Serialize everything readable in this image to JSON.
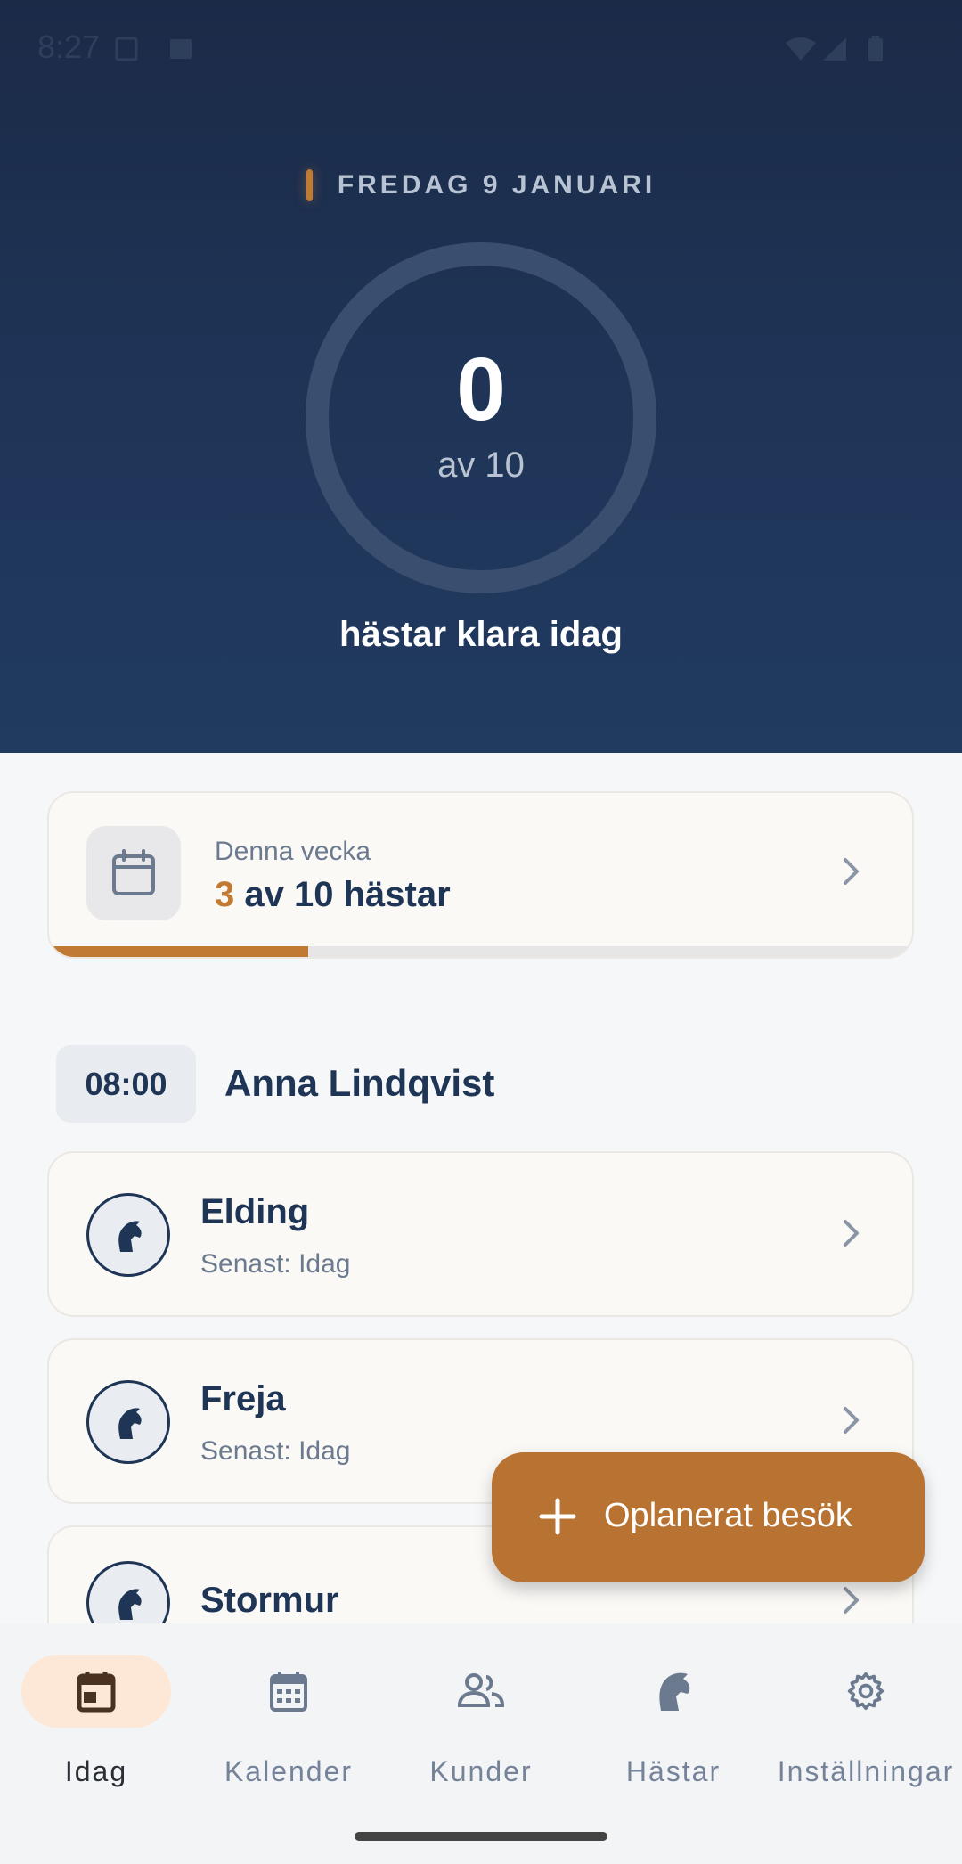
{
  "status_bar": {
    "time": "8:27"
  },
  "header": {
    "date": "FREDAG 9 JANUARI",
    "done_count": "0",
    "total_label": "av 10",
    "caption": "hästar klara idag",
    "progress_fraction": 0
  },
  "week": {
    "label": "Denna vecka",
    "done": "3",
    "rest": " av 10 hästar",
    "progress_fraction": 0.3
  },
  "visit": {
    "time": "08:00",
    "customer": "Anna Lindqvist",
    "horses": [
      {
        "name": "Elding",
        "subtitle": "Senast: Idag"
      },
      {
        "name": "Freja",
        "subtitle": "Senast: Idag"
      },
      {
        "name": "Stormur",
        "subtitle": ""
      }
    ]
  },
  "fab": {
    "label": "Oplanerat besök"
  },
  "nav": {
    "items": [
      {
        "label": "Idag",
        "icon": "calendar-today-icon"
      },
      {
        "label": "Kalender",
        "icon": "calendar-month-icon"
      },
      {
        "label": "Kunder",
        "icon": "people-icon"
      },
      {
        "label": "Hästar",
        "icon": "horse-head-icon"
      },
      {
        "label": "Inställningar",
        "icon": "gear-icon"
      }
    ],
    "active_index": 0
  },
  "colors": {
    "navy": "#1f3556",
    "accent": "#c07a34",
    "hero_bg": "#1f3558"
  }
}
